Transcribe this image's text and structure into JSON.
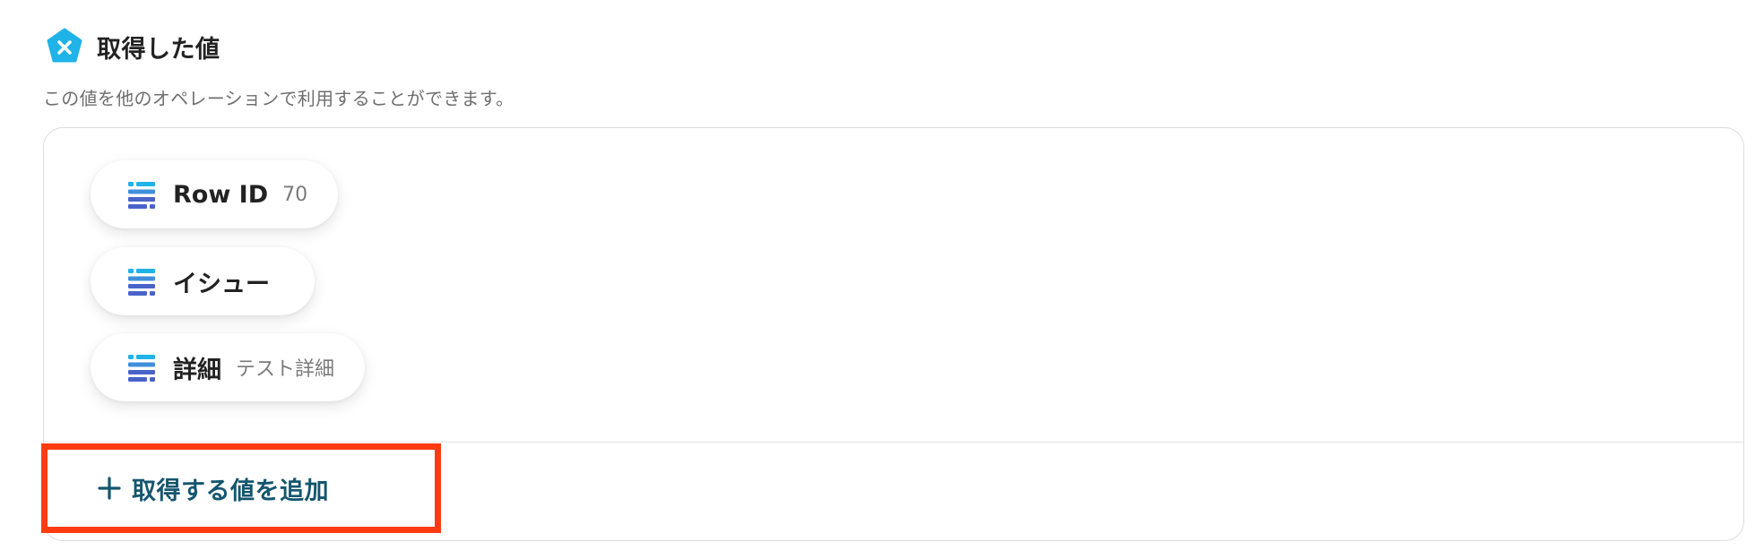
{
  "section": {
    "title": "取得した値",
    "title_icon": "x-pentagon-icon",
    "description": "この値を他のオペレーションで利用することができます。"
  },
  "values": [
    {
      "label": "Row ID",
      "value": "70",
      "icon": "table-rows-icon"
    },
    {
      "label": "イシュー",
      "value": "",
      "icon": "table-rows-icon"
    },
    {
      "label": "詳細",
      "value": "テスト詳細",
      "icon": "table-rows-icon"
    }
  ],
  "add_button": {
    "label": "取得する値を追加",
    "icon": "plus-icon"
  },
  "colors": {
    "accent_blue": "#1fb3e8",
    "icon_dark_blue": "#4a63c9",
    "add_text": "#14566f",
    "highlight_border": "#ff3b12"
  }
}
